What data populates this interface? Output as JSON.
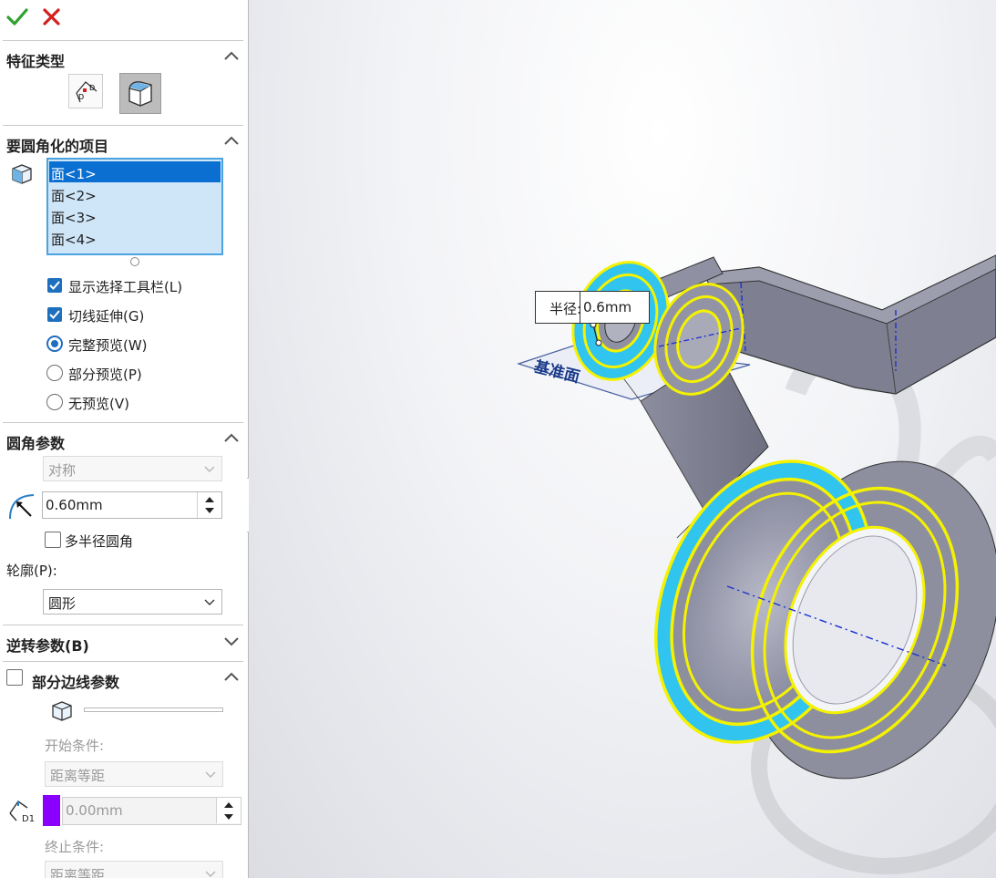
{
  "toolbar": {
    "ok_icon": "checkmark-icon",
    "cancel_icon": "x-icon",
    "ok_color": "#2ea12e",
    "cancel_color": "#d42020"
  },
  "feature_type": {
    "title": "特征类型"
  },
  "items": {
    "title": "要圆角化的项目",
    "list": [
      "面<1>",
      "面<2>",
      "面<3>",
      "面<4>"
    ],
    "show_toolbar": "显示选择工具栏(L)",
    "tangent": "切线延伸(G)",
    "full_preview": "完整预览(W)",
    "partial_preview": "部分预览(P)",
    "no_preview": "无预览(V)"
  },
  "params": {
    "title": "圆角参数",
    "mode": "对称",
    "radius": "0.60mm",
    "multi_radius": "多半径圆角",
    "profile_label": "轮廓(P):",
    "profile": "圆形"
  },
  "setback": {
    "title": "逆转参数(B)"
  },
  "partial_edge": {
    "title": "部分边线参数",
    "start_label": "开始条件:",
    "start": "距离等距",
    "distance": "0.00mm",
    "d1": "D1",
    "swatch_color": "#8a00ff",
    "end_label": "终止条件:",
    "end": "距离等距"
  },
  "viewport": {
    "callout_label": "半径:",
    "callout_value": "0.6mm",
    "plane_text": "基准面"
  }
}
